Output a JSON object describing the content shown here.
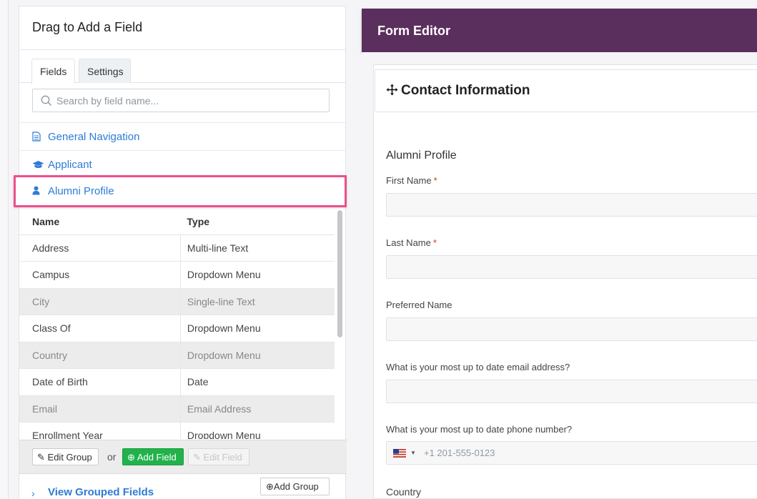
{
  "left_panel": {
    "title": "Drag to Add a Field",
    "tabs": [
      {
        "label": "Fields"
      },
      {
        "label": "Settings"
      }
    ],
    "search": {
      "placeholder": "Search by field name..."
    },
    "groups": [
      {
        "label": "General Navigation",
        "icon": "document-icon"
      },
      {
        "label": "Applicant",
        "icon": "graduation-cap-icon"
      },
      {
        "label": "Alumni Profile",
        "icon": "user-icon"
      }
    ],
    "table": {
      "headers": [
        "Name",
        "Type"
      ],
      "rows": [
        {
          "name": "Address",
          "type": "Multi-line Text",
          "disabled": false
        },
        {
          "name": "Campus",
          "type": "Dropdown Menu",
          "disabled": false
        },
        {
          "name": "City",
          "type": "Single-line Text",
          "disabled": true
        },
        {
          "name": "Class Of",
          "type": "Dropdown Menu",
          "disabled": false
        },
        {
          "name": "Country",
          "type": "Dropdown Menu",
          "disabled": true
        },
        {
          "name": "Date of Birth",
          "type": "Date",
          "disabled": false
        },
        {
          "name": "Email",
          "type": "Email Address",
          "disabled": true
        },
        {
          "name": "Enrollment Year",
          "type": "Dropdown Menu",
          "disabled": false
        }
      ]
    },
    "actions": {
      "edit_group": "Edit Group",
      "or": "or",
      "add_field": "Add Field",
      "edit_field": "Edit Field"
    },
    "grouped": {
      "label": "View Grouped Fields",
      "add_group": "Add Group"
    }
  },
  "editor": {
    "title": "Form Editor",
    "section": "Contact Information",
    "form_title": "Alumni Profile",
    "fields": [
      {
        "label": "First Name",
        "required": true
      },
      {
        "label": "Last Name",
        "required": true
      },
      {
        "label": "Preferred Name",
        "required": false
      },
      {
        "label": "What is your most up to date email address?",
        "required": false
      },
      {
        "label": "What is your most up to date phone number?",
        "required": false,
        "placeholder": "+1 201-555-0123"
      },
      {
        "label": "Country",
        "required": false
      }
    ],
    "required_mark": "*"
  },
  "colors": {
    "accent_link": "#2e7bd6",
    "header_purple": "#5a2f5d",
    "add_green": "#22b24c",
    "highlight_pink": "#ec4f8c"
  }
}
